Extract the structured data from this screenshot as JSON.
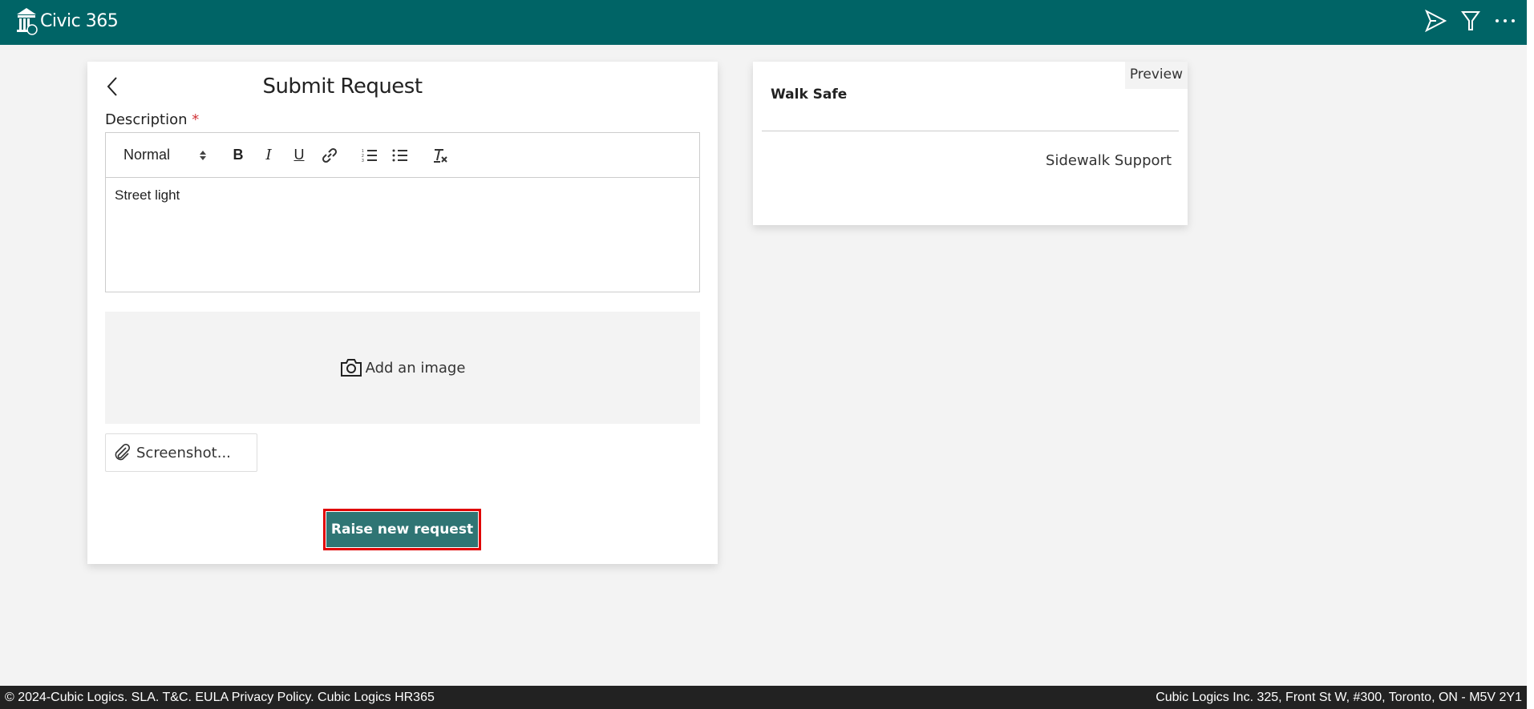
{
  "header": {
    "app_title": "Civic 365",
    "icons": [
      "send-icon",
      "filter-icon",
      "more-icon"
    ]
  },
  "form": {
    "title": "Submit Request",
    "description_label": "Description",
    "required_mark": "*",
    "toolbar": {
      "format_select": "Normal",
      "buttons": [
        "bold",
        "italic",
        "underline",
        "link",
        "ordered-list",
        "bullet-list",
        "clear-format"
      ]
    },
    "bold": "B",
    "italic": "I",
    "underline": "U",
    "description_value": "Street light",
    "add_image_label": "Add an image",
    "screenshot_label": "Screenshot...",
    "submit_label": "Raise new request"
  },
  "preview": {
    "badge": "Preview",
    "title": "Walk Safe",
    "category": "Sidewalk Support"
  },
  "footer": {
    "left": "© 2024-Cubic Logics. SLA. T&C. EULA Privacy Policy. Cubic Logics HR365",
    "right": "Cubic Logics Inc. 325, Front St W, #300, Toronto, ON - M5V 2Y1"
  },
  "colors": {
    "header": "#006466",
    "button": "#2f7574",
    "highlight": "#e00000",
    "footer": "#222222"
  }
}
